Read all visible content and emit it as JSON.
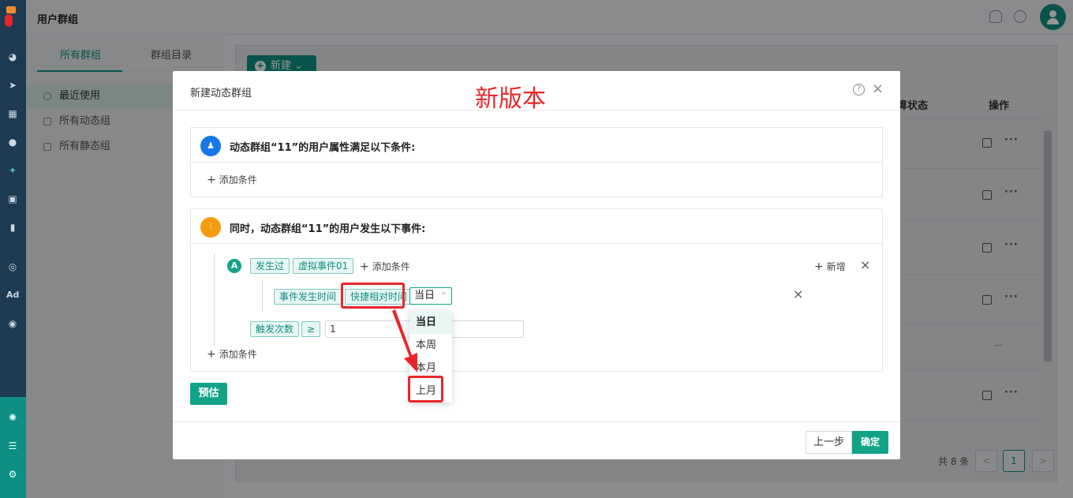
{
  "app": {
    "page_title": "用户群组"
  },
  "group_panel": {
    "tabs": [
      {
        "label": "所有群组"
      },
      {
        "label": "群组目录"
      }
    ],
    "items": [
      {
        "label": "最近使用"
      },
      {
        "label": "所有动态组"
      },
      {
        "label": "所有静态组"
      }
    ]
  },
  "main": {
    "new_button_label": "新建",
    "columns": {
      "status": "算状态",
      "actions": "操作"
    },
    "row_dash": "--",
    "pagination": {
      "total_text": "共 8 条",
      "current_page": "1",
      "prev": "<",
      "next": ">"
    }
  },
  "rail": {
    "ad_label": "Ad"
  },
  "modal": {
    "title": "新建动态群组",
    "version_label": "新版本",
    "help_icon": "?",
    "close_icon": "×",
    "attr_section": {
      "title": "动态群组“11”的用户属性满足以下条件:",
      "add_condition": "添加条件"
    },
    "event_section": {
      "title": "同时，动态群组“11”的用户发生以下事件:",
      "rule_badge": "A",
      "occurred_tag": "发生过",
      "event_tag": "虚拟事件01",
      "add_condition": "添加条件",
      "add_new": "新增",
      "time_tag": "事件发生时间",
      "quick_time_tag": "快捷相对时间",
      "time_select": {
        "value": "当日"
      },
      "dropdown_options": [
        "当日",
        "本周",
        "本月",
        "上月"
      ],
      "trigger_tag": "触发次数",
      "operator_tag": "≥",
      "count_value": "1",
      "add_condition_bottom": "添加条件"
    },
    "estimate_button": "预估",
    "footer": {
      "prev_button": "上一步",
      "ok_button": "确定"
    }
  }
}
